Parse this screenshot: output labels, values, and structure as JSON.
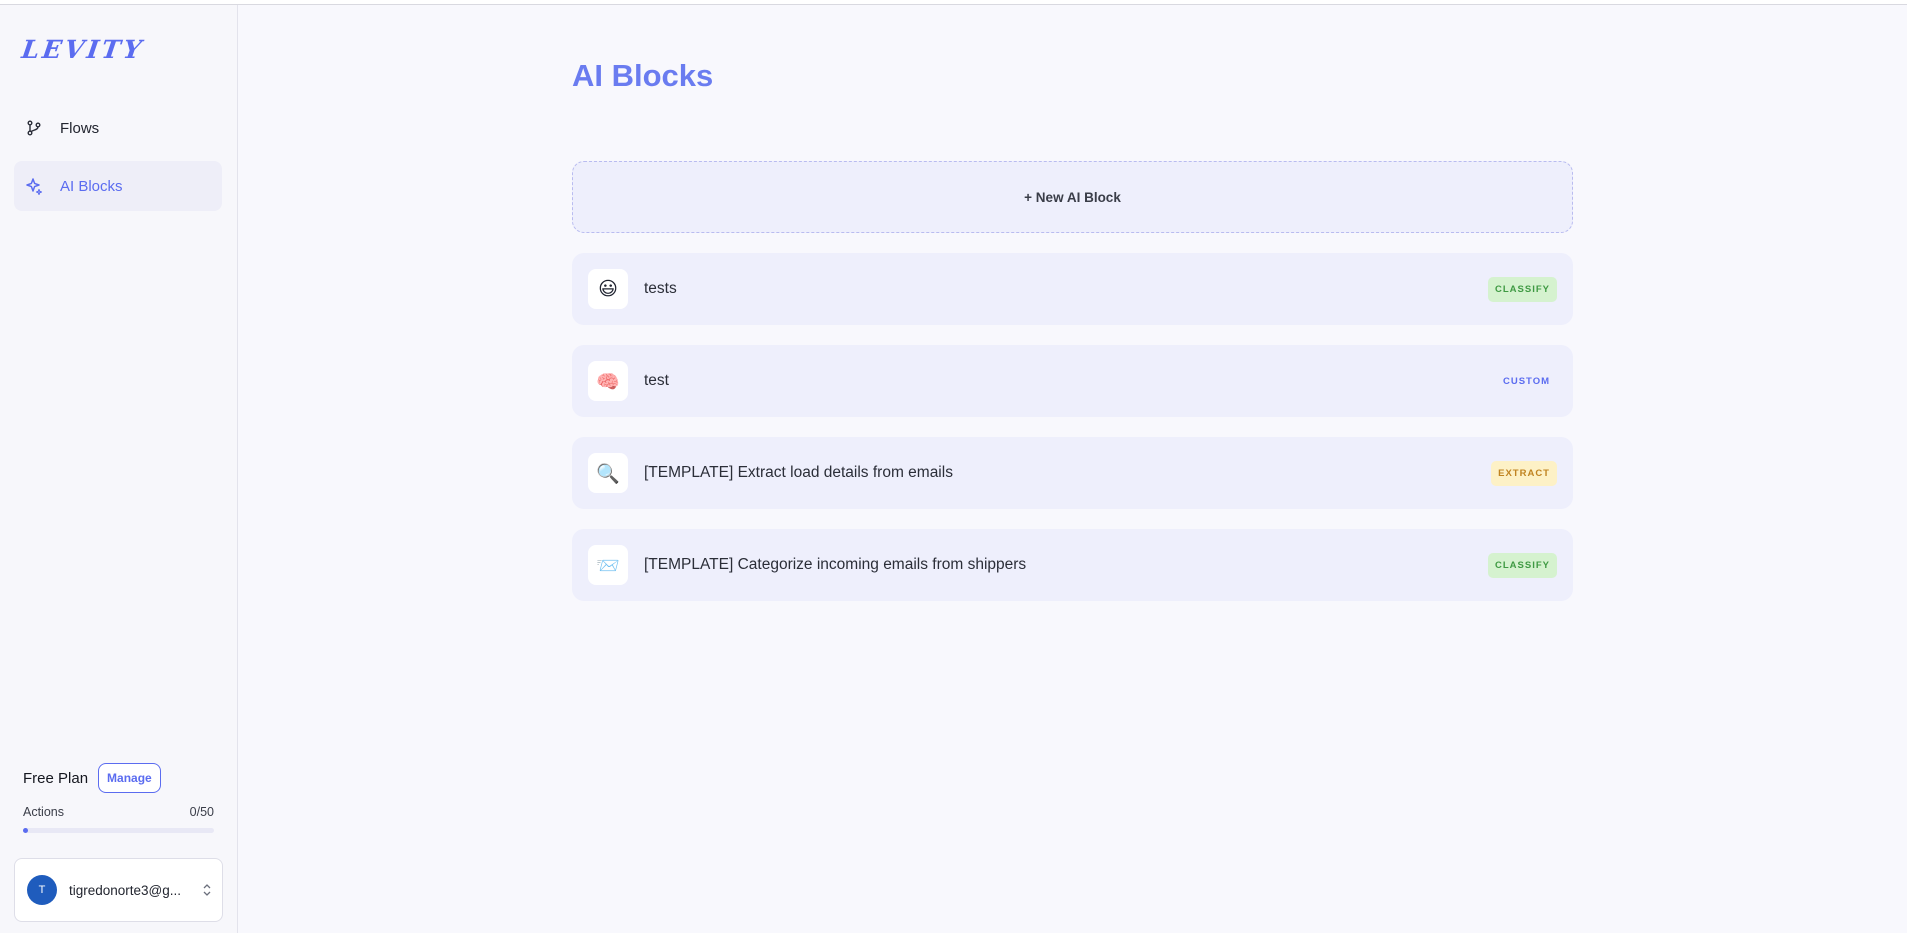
{
  "sidebar": {
    "logo": "LEVITY",
    "nav": [
      {
        "label": "Flows",
        "icon": "git-branch-icon"
      },
      {
        "label": "AI Blocks",
        "icon": "sparkle-icon"
      }
    ],
    "active_nav": "AI Blocks",
    "plan": {
      "name": "Free Plan",
      "manage_label": "Manage",
      "actions_label": "Actions",
      "actions_value": "0/50",
      "actions_progress_fraction": 0.0
    },
    "user": {
      "avatar_initial": "T",
      "email": "tigredonorte3@g..."
    }
  },
  "main": {
    "title": "AI Blocks",
    "new_block_label": "+ New AI Block",
    "blocks": [
      {
        "emoji": "😃",
        "name": "tests",
        "badge": "CLASSIFY",
        "badge_type": "classify"
      },
      {
        "emoji": "🧠",
        "name": "test",
        "badge": "CUSTOM",
        "badge_type": "custom"
      },
      {
        "emoji": "🔍",
        "name": "[TEMPLATE] Extract load details from emails",
        "badge": "EXTRACT",
        "badge_type": "extract"
      },
      {
        "emoji": "📨",
        "name": "[TEMPLATE] Categorize incoming emails from shippers",
        "badge": "CLASSIFY",
        "badge_type": "classify"
      }
    ]
  },
  "colors": {
    "accent": "#5b6cf0",
    "classify_bg": "#d5f2cf",
    "extract_bg": "#fdf1c6"
  }
}
